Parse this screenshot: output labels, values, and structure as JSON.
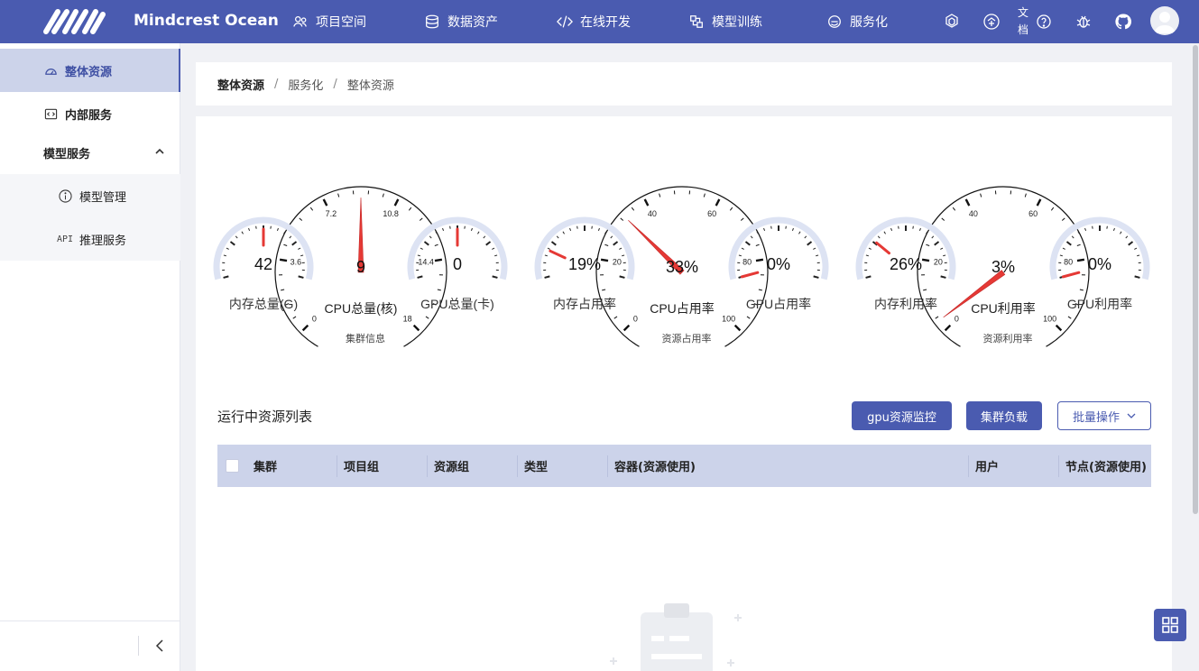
{
  "app": {
    "brand": "Mindcrest Ocean"
  },
  "nav": [
    {
      "label": "项目空间",
      "icon": "users-icon"
    },
    {
      "label": "数据资产",
      "icon": "database-icon"
    },
    {
      "label": "在线开发",
      "icon": "code-icon"
    },
    {
      "label": "模型训练",
      "icon": "model-train-icon"
    },
    {
      "label": "服务化",
      "icon": "service-icon"
    }
  ],
  "header_right": {
    "doc_label": "文档"
  },
  "sidebar": {
    "items": [
      {
        "label": "整体资源",
        "active": true
      },
      {
        "label": "内部服务",
        "active": false
      },
      {
        "label": "模型服务",
        "expanded": true
      },
      {
        "label": "模型管理"
      },
      {
        "label": "推理服务"
      }
    ],
    "api_glyph": "API"
  },
  "breadcrumb": [
    "整体资源",
    "服务化",
    "整体资源"
  ],
  "gauge_groups": [
    {
      "caption": "集群信息",
      "gauges": [
        {
          "label": "内存总量(G)",
          "value": "42"
        },
        {
          "label": "CPU总量(核)",
          "value": "9",
          "ticks": [
            "0",
            "3.6",
            "7.2",
            "10.8",
            "14.4",
            "18"
          ]
        },
        {
          "label": "GPU总量(卡)",
          "value": "0"
        }
      ]
    },
    {
      "caption": "资源占用率",
      "gauges": [
        {
          "label": "内存占用率",
          "value": "19%"
        },
        {
          "label": "CPU占用率",
          "value": "33%",
          "ticks": [
            "0",
            "20",
            "40",
            "60",
            "80",
            "100"
          ]
        },
        {
          "label": "GPU占用率",
          "value": "0%"
        }
      ]
    },
    {
      "caption": "资源利用率",
      "gauges": [
        {
          "label": "内存利用率",
          "value": "26%"
        },
        {
          "label": "CPU利用率",
          "value": "3%",
          "ticks": [
            "0",
            "20",
            "40",
            "60",
            "80",
            "100"
          ]
        },
        {
          "label": "GPU利用率",
          "value": "0%"
        }
      ]
    }
  ],
  "resources": {
    "title": "运行中资源列表",
    "buttons": {
      "gpu_monitor": "gpu资源监控",
      "cluster_load": "集群负载",
      "batch_ops": "批量操作"
    },
    "columns": [
      "集群",
      "项目组",
      "资源组",
      "类型",
      "容器(资源使用)",
      "用户",
      "节点(资源使用)"
    ]
  },
  "colors": {
    "primary": "#4a5bb0",
    "gauge_arc": "#dde3f3",
    "needle": "#e53935"
  }
}
